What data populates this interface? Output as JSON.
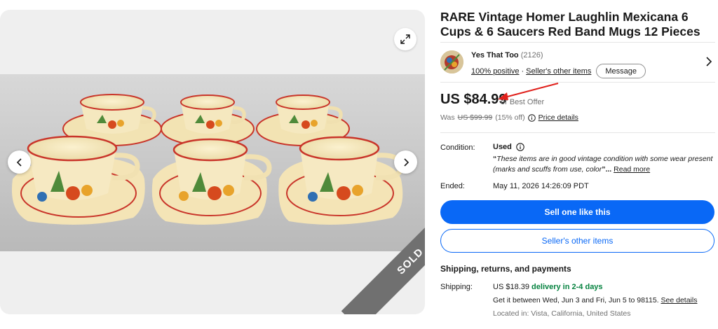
{
  "gallery": {
    "sold_label": "SOLD",
    "icons": {
      "expand": "expand-icon",
      "prev": "chevron-left-icon",
      "next": "chevron-right-icon"
    }
  },
  "listing": {
    "title": "RARE Vintage Homer Laughlin Mexicana 6 Cups & 6 Saucers Red Band Mugs 12 Pieces"
  },
  "seller": {
    "name": "Yes That Too",
    "feedback_count": "(2126)",
    "positive": "100% positive",
    "separator": "·",
    "other_items": "Seller's other items",
    "message_button": "Message"
  },
  "price": {
    "amount": "US $84.99",
    "offer": "or Best Offer",
    "was_prefix": "Was",
    "was_amount": "US $99.99",
    "discount": "(15% off)",
    "price_details": "Price details"
  },
  "condition": {
    "label": "Condition:",
    "value": "Used",
    "quote_open": "“",
    "description": "These items are in good vintage condition with some wear present (marks and scuffs from use, color",
    "quote_close": "”...",
    "read_more": "Read more"
  },
  "ended": {
    "label": "Ended:",
    "value": "May 11, 2026 14:26:09 PDT"
  },
  "actions": {
    "sell_one": "Sell one like this",
    "seller_other_items": "Seller's other items"
  },
  "shipping": {
    "heading": "Shipping, returns, and payments",
    "label": "Shipping:",
    "cost": "US $18.39",
    "delivery": "delivery in 2-4 days",
    "estimate": "Get it between Wed, Jun 3 and Fri, Jun 5 to 98115.",
    "see_details": "See details",
    "location": "Located in: Vista, California, United States"
  },
  "colors": {
    "primary_blue": "#0968f6",
    "green": "#05823f",
    "arrow_red": "#e0201b",
    "sold_ribbon": "#707070"
  }
}
